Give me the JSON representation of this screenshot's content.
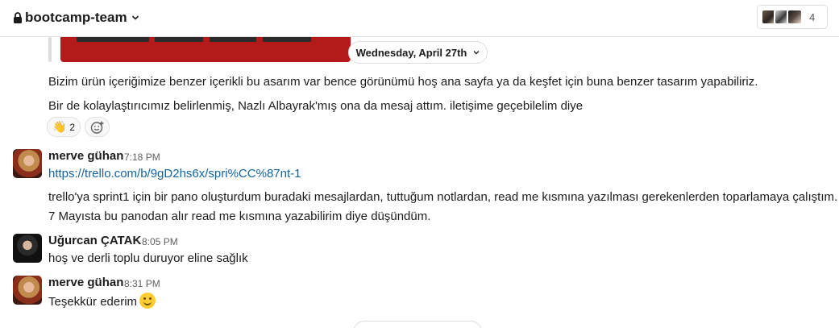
{
  "header": {
    "channel_name": "bootcamp-team",
    "member_count": "4"
  },
  "divider": {
    "date_label": "Wednesday, April 27th"
  },
  "messages": [
    {
      "text": "Bizim ürün içeriğimize benzer içerikli bu asarım var bence görünümü hoş ana sayfa ya da keşfet için buna benzer tasarım yapabiliriz."
    },
    {
      "text": "Bir de kolaylaştırıcımız belirlenmiş, Nazlı Albayrak'mış ona da mesaj attım. iletişime geçebilelim diye"
    }
  ],
  "reactions": [
    {
      "emoji": "👋",
      "count": "2"
    }
  ],
  "posts": [
    {
      "sender": "merve gühan",
      "time": "7:18 PM",
      "link": "https://trello.com/b/9gD2hs6x/spri%CC%87nt-1",
      "lines": [
        "trello'ya sprint1 için bir pano oluşturdum buradaki mesajlardan, tuttuğum notlardan, read me kısmına yazılması gerekenlerden toparlamaya çalıştım.",
        "7 Mayısta bu panodan alır read me kısmına yazabilirim diye düşündüm."
      ]
    },
    {
      "sender": "Uğurcan ÇATAK",
      "time": "8:05 PM",
      "lines": [
        "hoş ve derli toplu duruyor eline sağlık"
      ]
    },
    {
      "sender": "merve gühan",
      "time": "8:31 PM",
      "lines": [
        "Teşekkür ederim"
      ]
    }
  ],
  "icons": {
    "lock": "lock-icon",
    "chevron": "chevron-down-icon",
    "add_reaction": "add-reaction-icon",
    "smile": "smiling-face-emoji"
  }
}
